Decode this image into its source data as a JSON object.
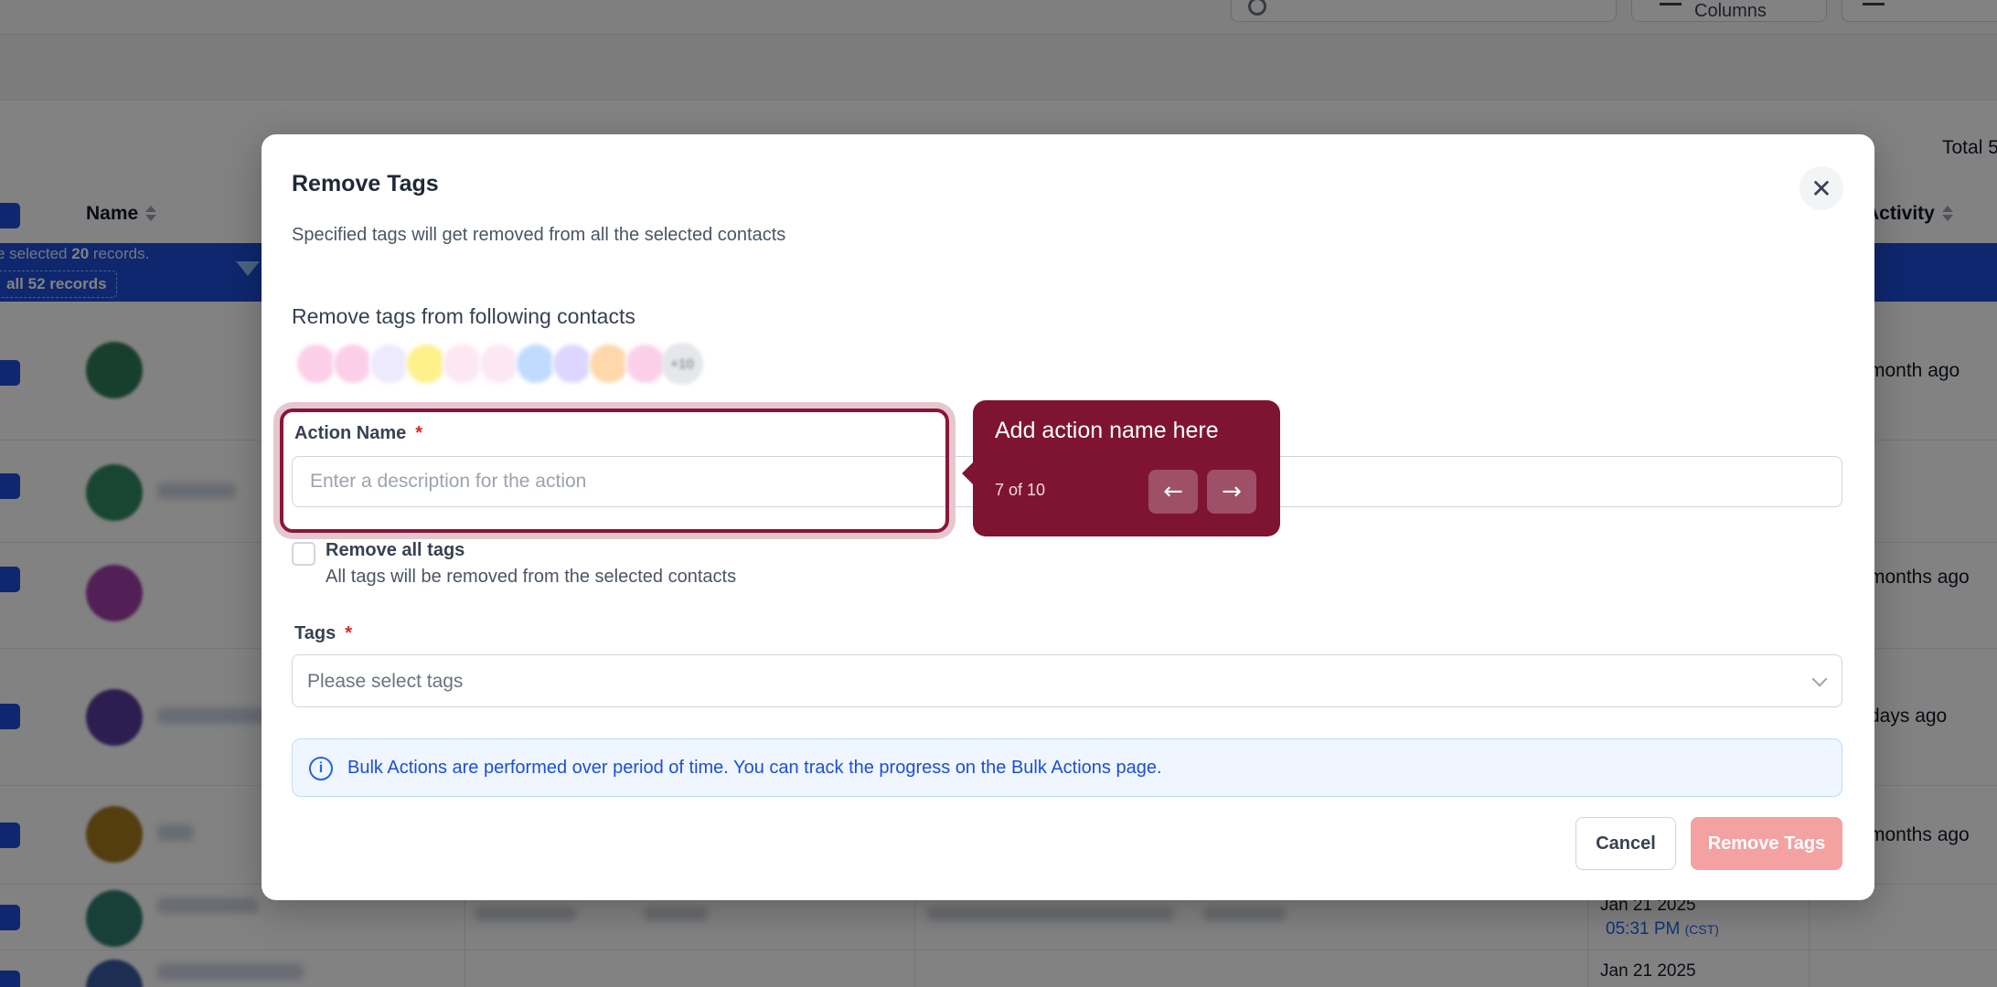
{
  "background": {
    "toolbar": {
      "columns_label": "Columns"
    },
    "total_label": "Total 5",
    "table": {
      "name_header": "Name",
      "activity_header": "Activity",
      "selection_text_prefix": "e selected ",
      "selection_count": "20",
      "selection_text_suffix": " records.",
      "select_all_label": "all 52 records"
    },
    "rows": [
      {
        "activity": "month ago",
        "avatar_color": "#2f7d5a"
      },
      {
        "activity": "",
        "avatar_color": "#2f8a63"
      },
      {
        "activity": "months ago",
        "avatar_color": "#a23ea9"
      },
      {
        "activity": "days ago",
        "avatar_color": "#5b3a9e"
      },
      {
        "activity": "months ago",
        "avatar_color": "#a57a1e"
      },
      {
        "activity": "",
        "avatar_color": "#2f7d70",
        "date": "Jan 21 2025",
        "time": "05:31 PM",
        "tz": "(CST)"
      },
      {
        "activity": "",
        "avatar_color": "#3b5aa3",
        "date": "Jan 21 2025"
      }
    ]
  },
  "modal": {
    "title": "Remove Tags",
    "subtitle": "Specified tags will get removed from all the selected contacts",
    "contacts_section_label": "Remove tags from following contacts",
    "contacts_more": "+10",
    "contact_chips": [
      {
        "color": "#fbcfe8"
      },
      {
        "color": "#fbcfe8"
      },
      {
        "color": "#ede9fe"
      },
      {
        "color": "#fef08a"
      },
      {
        "color": "#fce7f3"
      },
      {
        "color": "#fce7f3"
      },
      {
        "color": "#bfdbfe"
      },
      {
        "color": "#ddd6fe"
      },
      {
        "color": "#fed7aa"
      },
      {
        "color": "#fbcfe8"
      }
    ],
    "action_name": {
      "label": "Action Name",
      "required_mark": "*",
      "value": "",
      "placeholder": "Enter a description for the action"
    },
    "remove_all": {
      "label": "Remove all tags",
      "description": "All tags will be removed from the selected contacts",
      "checked": false
    },
    "tags": {
      "label": "Tags",
      "required_mark": "*",
      "placeholder": "Please select tags"
    },
    "info_text": "Bulk Actions are performed over period of time. You can track the progress on the Bulk Actions page.",
    "cancel_label": "Cancel",
    "submit_label": "Remove Tags",
    "accent_color": "#f4a1a1"
  },
  "tour": {
    "title": "Add action name here",
    "step_text": "7 of 10",
    "prev_icon": "arrow-left-icon",
    "next_icon": "arrow-right-icon",
    "color": "#7e1432"
  }
}
